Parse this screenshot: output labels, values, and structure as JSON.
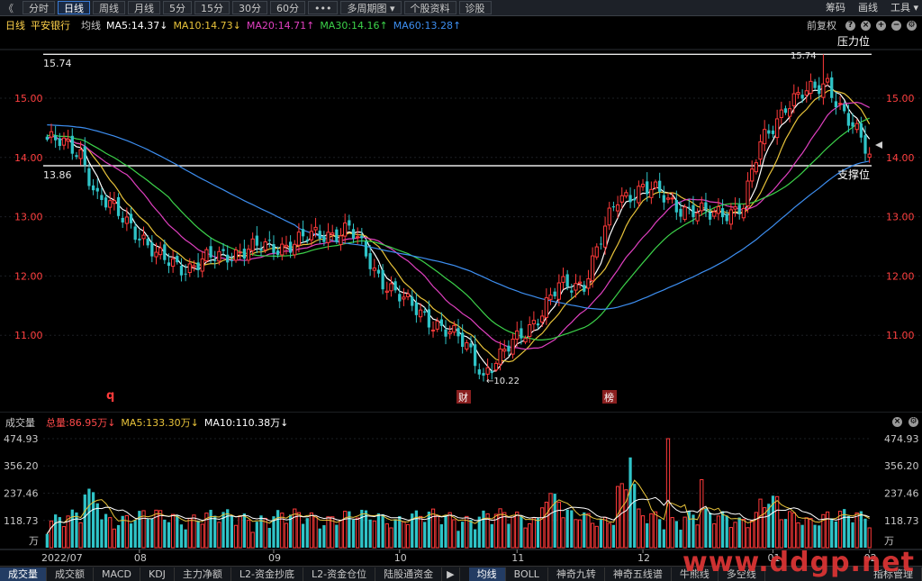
{
  "toolbar": {
    "back": "《",
    "tabs": [
      "分时",
      "日线",
      "周线",
      "月线",
      "5分",
      "15分",
      "30分",
      "60分",
      "•••",
      "多周期图 ▾",
      "个股资料",
      "诊股"
    ],
    "active_tab": "日线",
    "right": [
      "筹码",
      "画线",
      "工具 ▾"
    ]
  },
  "infobar": {
    "period": "日线",
    "stock": "平安银行",
    "ma_label": "均线",
    "ma5": "MA5:14.37↓",
    "ma10": "MA10:14.73↓",
    "ma20": "MA20:14.71↑",
    "ma30": "MA30:14.16↑",
    "ma60": "MA60:13.28↑",
    "adjust": "前复权"
  },
  "volbar": {
    "label": "成交量",
    "total": "总量:86.95万↓",
    "ma5": "MA5:133.30万↓",
    "ma10": "MA10:110.38万↓"
  },
  "colors": {
    "up": "#ff3a3a",
    "down": "#2fc4c8",
    "ma5": "#ffffff",
    "ma10": "#e8c33a",
    "ma20": "#e040c0",
    "ma30": "#3cd24a",
    "ma60": "#3d8ef0",
    "accent": "#3a7bd5"
  },
  "price_chart": {
    "y_ticks": [
      "15.00",
      "14.00",
      "13.00",
      "12.00",
      "11.00"
    ],
    "resistance_value": "15.74",
    "resistance_label": "压力位",
    "resistance_top_label": "15.74",
    "support_value": "13.86",
    "support_label": "支撑位",
    "low_label": "←10.22",
    "markers": [
      "q",
      "财",
      "榜"
    ]
  },
  "volume_chart": {
    "y_ticks": [
      "474.93",
      "356.20",
      "237.46",
      "118.73"
    ],
    "unit": "万"
  },
  "x_axis": [
    "2022/07",
    "08",
    "09",
    "10",
    "11",
    "12",
    "01",
    "02"
  ],
  "bottom_tabs": [
    "成交量",
    "成交额",
    "MACD",
    "KDJ",
    "主力净额",
    "L2-资金抄底",
    "L2-资金仓位",
    "陆股通资金",
    "▶",
    "均线",
    "BOLL",
    "神奇九转",
    "神奇五线谱",
    "牛熊线",
    "多空线",
    "指标管理"
  ],
  "watermark": "www.ddgp.net",
  "chart_data": {
    "type": "candlestick",
    "title": "平安银行 日线",
    "x_period_labels": [
      "2022/07",
      "08",
      "09",
      "10",
      "11",
      "12",
      "01",
      "02"
    ],
    "ylim": [
      10.2,
      15.75
    ],
    "resistance": 15.74,
    "support": 13.86,
    "low": 10.22,
    "high": 15.74,
    "ma_last": {
      "MA5": 14.37,
      "MA10": 14.73,
      "MA20": 14.71,
      "MA30": 14.16,
      "MA60": 13.28
    },
    "close_anchors": [
      {
        "x": 0,
        "y": 14.3
      },
      {
        "x": 8,
        "y": 14.1
      },
      {
        "x": 12,
        "y": 13.3
      },
      {
        "x": 20,
        "y": 12.9
      },
      {
        "x": 26,
        "y": 12.3
      },
      {
        "x": 34,
        "y": 12.15
      },
      {
        "x": 44,
        "y": 12.4
      },
      {
        "x": 55,
        "y": 12.5
      },
      {
        "x": 66,
        "y": 12.7
      },
      {
        "x": 72,
        "y": 12.8
      },
      {
        "x": 78,
        "y": 12.1
      },
      {
        "x": 86,
        "y": 11.5
      },
      {
        "x": 93,
        "y": 11.2
      },
      {
        "x": 100,
        "y": 10.8
      },
      {
        "x": 104,
        "y": 10.4
      },
      {
        "x": 108,
        "y": 10.6
      },
      {
        "x": 114,
        "y": 11.1
      },
      {
        "x": 118,
        "y": 11.4
      },
      {
        "x": 122,
        "y": 11.8
      },
      {
        "x": 128,
        "y": 11.9
      },
      {
        "x": 132,
        "y": 12.6
      },
      {
        "x": 136,
        "y": 13.3
      },
      {
        "x": 142,
        "y": 13.5
      },
      {
        "x": 150,
        "y": 13.2
      },
      {
        "x": 158,
        "y": 13.0
      },
      {
        "x": 166,
        "y": 13.2
      },
      {
        "x": 170,
        "y": 14.2
      },
      {
        "x": 176,
        "y": 14.9
      },
      {
        "x": 182,
        "y": 15.1
      },
      {
        "x": 186,
        "y": 15.3
      },
      {
        "x": 190,
        "y": 14.7
      },
      {
        "x": 196,
        "y": 14.05
      }
    ],
    "n_days": 197,
    "volume_ylim": [
      0,
      474.93
    ],
    "volume_peak": 474.93
  }
}
